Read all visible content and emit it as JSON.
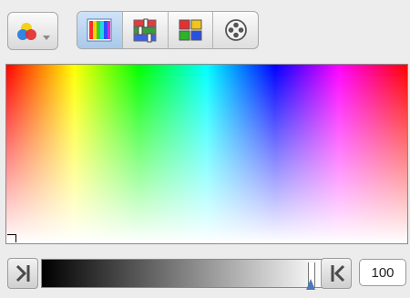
{
  "toolbar": {
    "palette_menu_icon": "color-circles-icon",
    "modes": [
      {
        "name": "spectrum",
        "icon": "spectrum-icon",
        "active": true
      },
      {
        "name": "sliders",
        "icon": "sliders-icon",
        "active": false
      },
      {
        "name": "swatches",
        "icon": "swatches-icon",
        "active": false
      },
      {
        "name": "color-wheel",
        "icon": "color-wheel-icon",
        "active": false
      }
    ]
  },
  "spectrum": {
    "hues": [
      "#ff0000",
      "#ffff00",
      "#00ff00",
      "#00ffff",
      "#0000ff",
      "#ff00ff",
      "#ff0000"
    ]
  },
  "gray_slider": {
    "value": 100,
    "value_label": "100",
    "start_color": "#000000",
    "end_color": "#ffffff"
  }
}
